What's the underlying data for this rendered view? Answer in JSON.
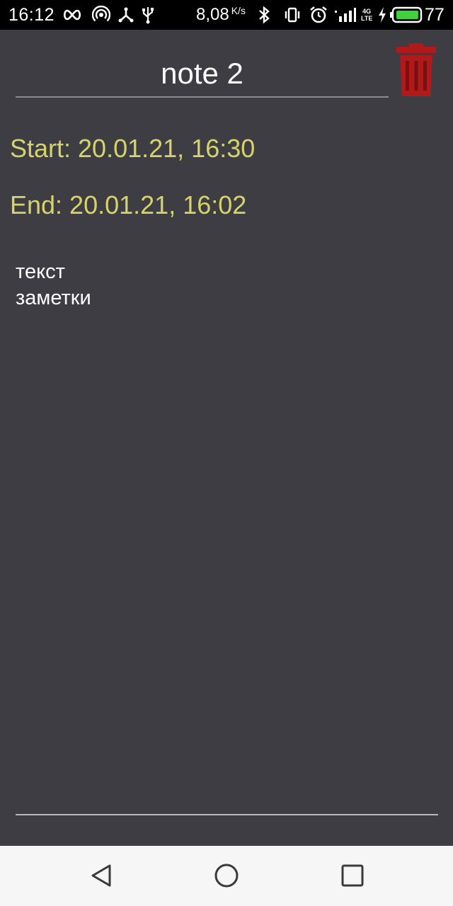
{
  "status_bar": {
    "time": "16:12",
    "net_speed": "8,08",
    "net_unit": "K/s",
    "network_type_top": "4G",
    "network_type_bottom": "LTE",
    "battery_level": "77",
    "icons": [
      "infinity-icon",
      "hotspot-icon",
      "share-icon",
      "usb-icon",
      "bluetooth-icon",
      "vibrate-icon",
      "alarm-icon",
      "signal-icon",
      "charging-icon",
      "battery-icon"
    ],
    "colors": {
      "background": "#000000",
      "text": "#ffffff",
      "battery_fill": "#3fd13f"
    }
  },
  "note": {
    "title": "note 2",
    "start_label": "Start: 20.01.21, 16:30",
    "end_label": "End: 20.01.21, 16:02",
    "body": "текст\nзаметки"
  },
  "actions": {
    "delete_icon": "trash-icon",
    "delete_color": "#b01a1a"
  },
  "nav_bar": {
    "icons": [
      "back-icon",
      "home-icon",
      "recents-icon"
    ],
    "color": "#3a3a3a"
  },
  "theme": {
    "background": "#3e3d44",
    "date_color": "#d6d468",
    "text_color": "#ffffff"
  }
}
